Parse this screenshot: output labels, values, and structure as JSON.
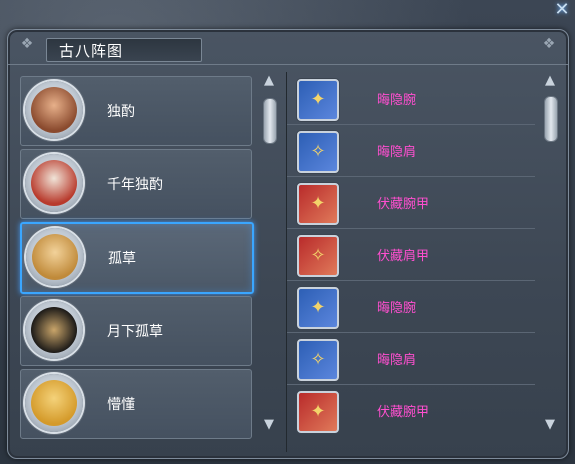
{
  "window": {
    "title": "古八阵图",
    "close_icon": "close-icon"
  },
  "characters": [
    {
      "name": "独酌",
      "avatar_color": "#8a4a2e"
    },
    {
      "name": "千年独酌",
      "avatar_color": "#b83a2c"
    },
    {
      "name": "孤草",
      "avatar_color": "#c08a3a",
      "selected": true
    },
    {
      "name": "月下孤草",
      "avatar_color": "#5a4a30"
    },
    {
      "name": "懵懂",
      "avatar_color": "#d49a2a"
    }
  ],
  "equipment": [
    {
      "name": "晦隐腕",
      "icon": "bracer-icon",
      "tone": "blue"
    },
    {
      "name": "晦隐肩",
      "icon": "shoulder-icon",
      "tone": "blue"
    },
    {
      "name": "伏藏腕甲",
      "icon": "bracer-armor-icon",
      "tone": "red"
    },
    {
      "name": "伏藏肩甲",
      "icon": "shoulder-armor-icon",
      "tone": "red"
    },
    {
      "name": "晦隐腕",
      "icon": "bracer-icon",
      "tone": "blue"
    },
    {
      "name": "晦隐肩",
      "icon": "shoulder-icon",
      "tone": "blue"
    },
    {
      "name": "伏藏腕甲",
      "icon": "bracer-armor-icon",
      "tone": "red"
    }
  ],
  "colors": {
    "accent_selected": "#3aa6ff",
    "equip_name": "#ff4fd0"
  }
}
